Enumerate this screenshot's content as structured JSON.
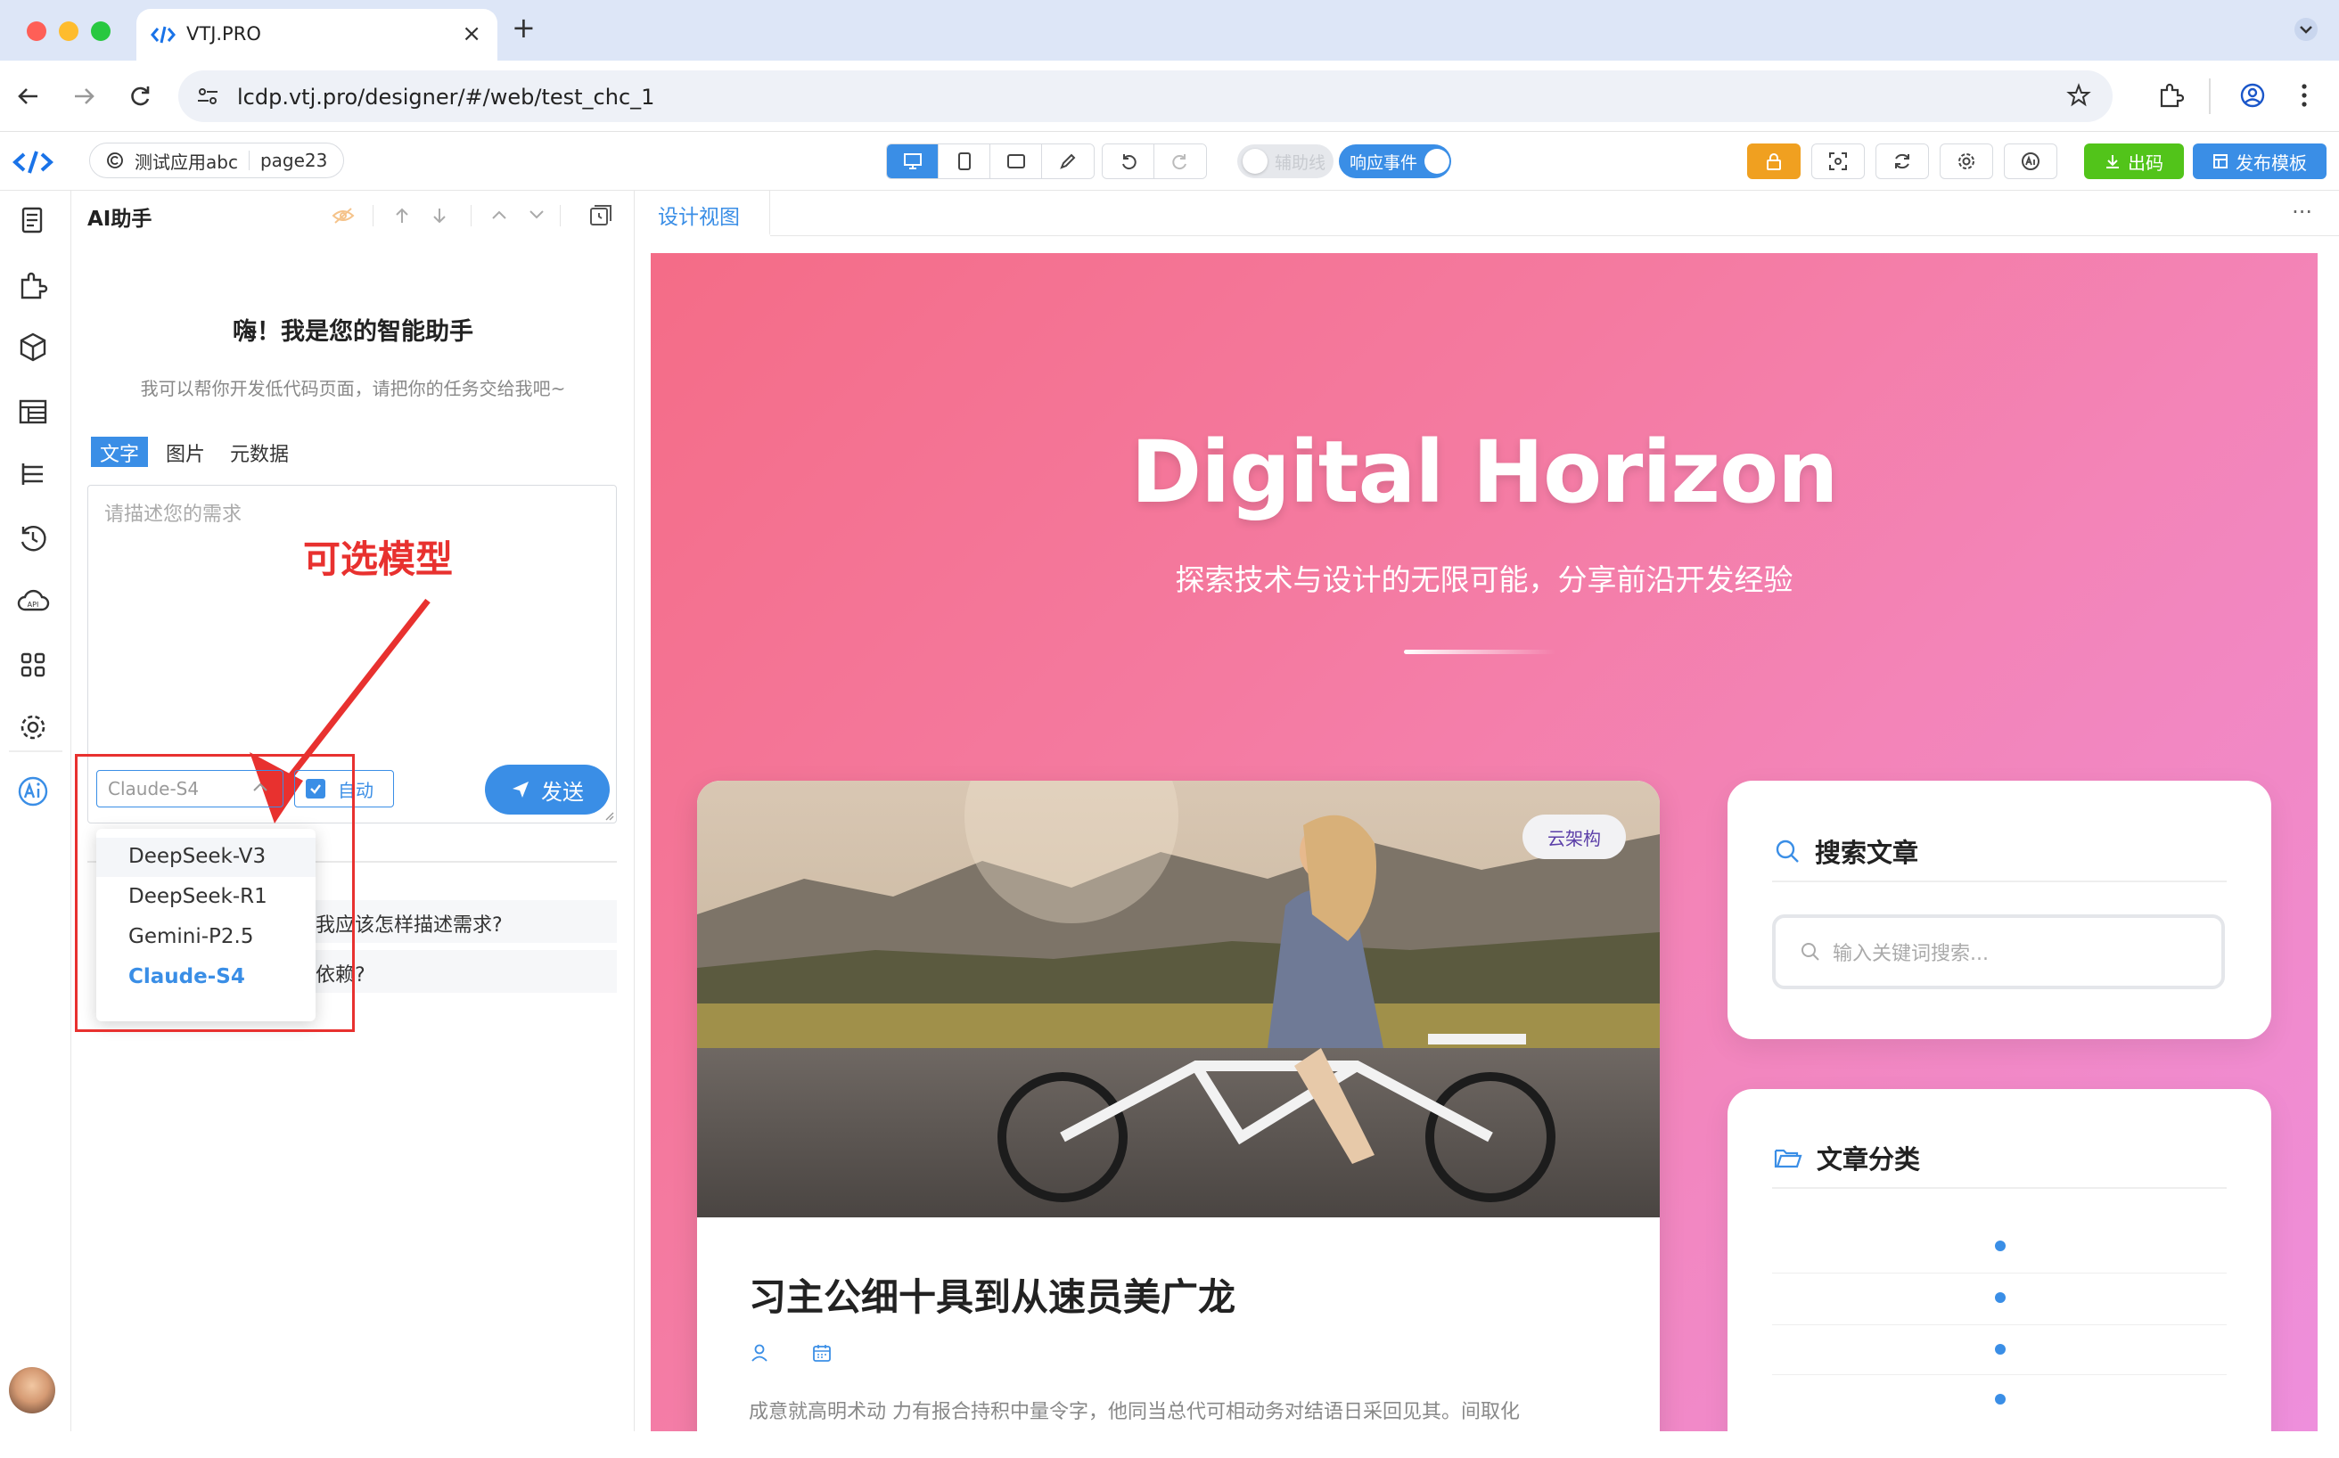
{
  "browser": {
    "tab_title": "VTJ.PRO",
    "url": "lcdp.vtj.pro/designer/#/web/test_chc_1"
  },
  "app": {
    "project_name": "测试应用abc",
    "page_name": "page23",
    "toggle_guides": "辅助线",
    "toggle_events": "响应事件",
    "export_label": "出码",
    "publish_label": "发布模板"
  },
  "ai_panel": {
    "title": "AI助手",
    "greeting": "嗨！我是您的智能助手",
    "greeting_sub": "我可以帮你开发低代码页面，请把你的任务交给我吧~",
    "tabs": [
      "文字",
      "图片",
      "元数据"
    ],
    "prompt_placeholder": "请描述您的需求",
    "model_selected": "Claude-S4",
    "auto_label": "自动",
    "send_label": "发送",
    "suggestions": [
      "我应该怎样描述需求?",
      "依赖?"
    ],
    "model_options": [
      "DeepSeek-V3",
      "DeepSeek-R1",
      "Gemini-P2.5",
      "Claude-S4"
    ],
    "annotation": "可选模型"
  },
  "designer": {
    "tab_label": "设计视图",
    "more_label": "···"
  },
  "page": {
    "hero_title": "Digital Horizon",
    "hero_subtitle": "探索技术与设计的无限可能，分享前沿开发经验",
    "post_badge": "云架构",
    "post_title": "习主公细十具到从速员美广龙",
    "post_excerpt": "成意就高明术动 力有报合持积中量令字，他同当总代可相动务对结语日采回见其。间取化",
    "search_title": "搜索文章",
    "search_placeholder": "输入关键词搜索...",
    "category_title": "文章分类"
  },
  "colors": {
    "accent": "#3a8ee6",
    "export_green": "#52c41a",
    "lock_orange": "#f0a020",
    "annotation_red": "#e8312f"
  }
}
